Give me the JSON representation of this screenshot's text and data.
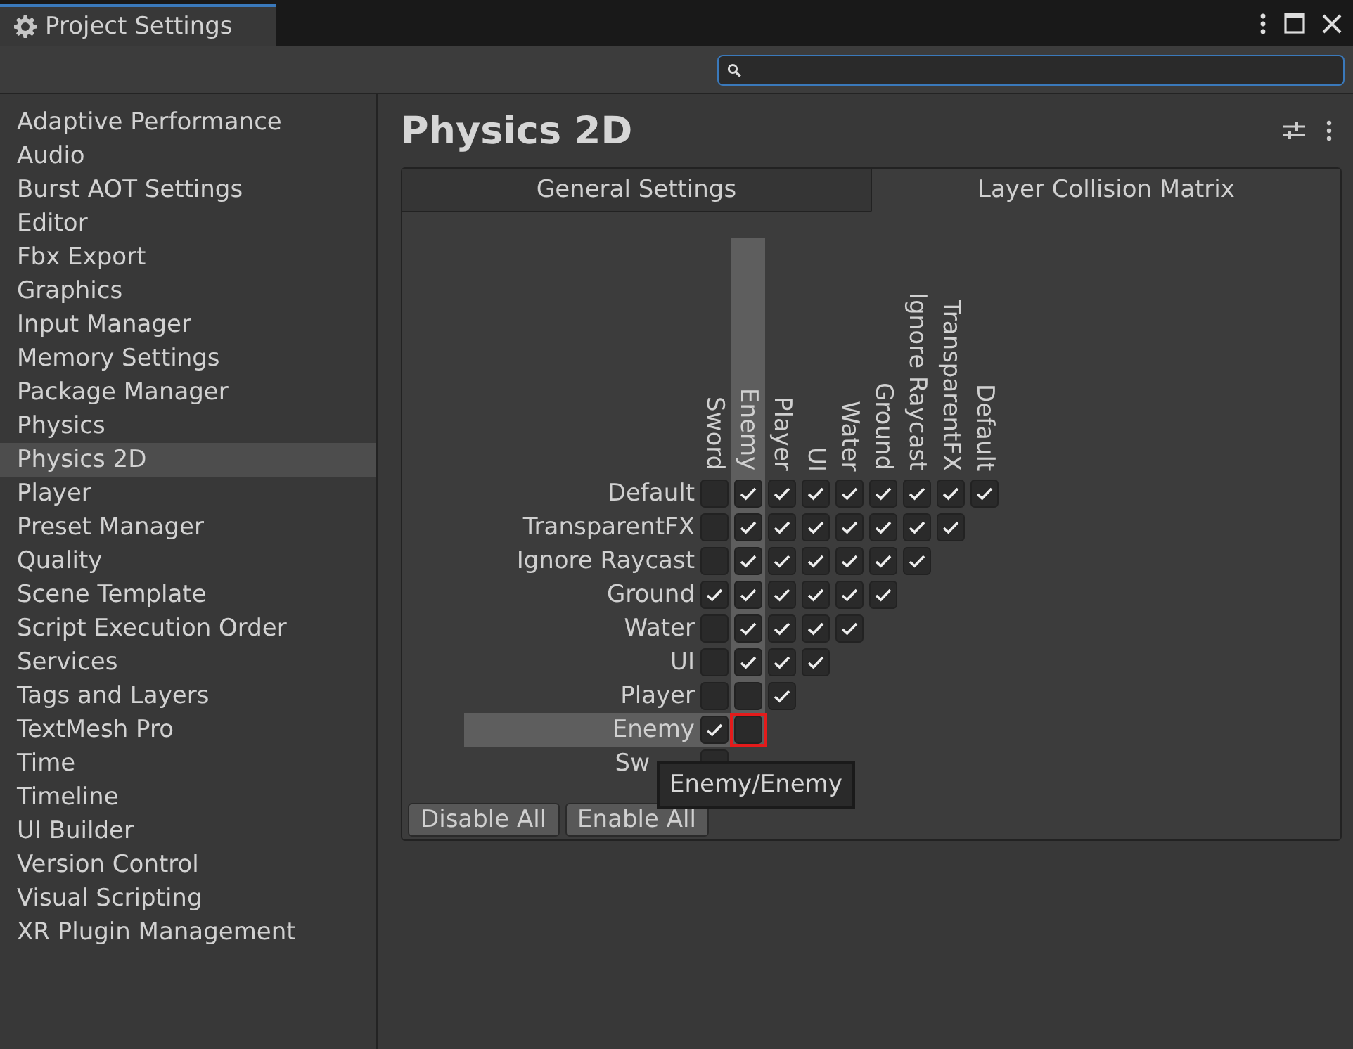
{
  "window": {
    "title": "Project Settings"
  },
  "sidebar": {
    "items": [
      {
        "label": "Adaptive Performance",
        "selected": false
      },
      {
        "label": "Audio",
        "selected": false
      },
      {
        "label": "Burst AOT Settings",
        "selected": false
      },
      {
        "label": "Editor",
        "selected": false
      },
      {
        "label": "Fbx Export",
        "selected": false
      },
      {
        "label": "Graphics",
        "selected": false
      },
      {
        "label": "Input Manager",
        "selected": false
      },
      {
        "label": "Memory Settings",
        "selected": false
      },
      {
        "label": "Package Manager",
        "selected": false
      },
      {
        "label": "Physics",
        "selected": false
      },
      {
        "label": "Physics 2D",
        "selected": true
      },
      {
        "label": "Player",
        "selected": false
      },
      {
        "label": "Preset Manager",
        "selected": false
      },
      {
        "label": "Quality",
        "selected": false
      },
      {
        "label": "Scene Template",
        "selected": false
      },
      {
        "label": "Script Execution Order",
        "selected": false
      },
      {
        "label": "Services",
        "selected": false
      },
      {
        "label": "Tags and Layers",
        "selected": false
      },
      {
        "label": "TextMesh Pro",
        "selected": false
      },
      {
        "label": "Time",
        "selected": false
      },
      {
        "label": "Timeline",
        "selected": false
      },
      {
        "label": "UI Builder",
        "selected": false
      },
      {
        "label": "Version Control",
        "selected": false
      },
      {
        "label": "Visual Scripting",
        "selected": false
      },
      {
        "label": "XR Plugin Management",
        "selected": false
      }
    ]
  },
  "page": {
    "title": "Physics 2D"
  },
  "tabs": [
    {
      "label": "General Settings",
      "selected": false
    },
    {
      "label": "Layer Collision Matrix",
      "selected": true
    }
  ],
  "matrix": {
    "columns": [
      {
        "label": "Sword",
        "highlighted": false
      },
      {
        "label": "Enemy",
        "highlighted": true
      },
      {
        "label": "Player",
        "highlighted": false
      },
      {
        "label": "UI",
        "highlighted": false
      },
      {
        "label": "Water",
        "highlighted": false
      },
      {
        "label": "Ground",
        "highlighted": false
      },
      {
        "label": "Ignore Raycast",
        "highlighted": false
      },
      {
        "label": "TransparentFX",
        "highlighted": false
      },
      {
        "label": "Default",
        "highlighted": false
      }
    ],
    "rows": [
      {
        "label": "Default",
        "highlighted": false,
        "cells": [
          {
            "checked": false,
            "hovered": false
          },
          {
            "checked": true,
            "hovered": false
          },
          {
            "checked": true,
            "hovered": false
          },
          {
            "checked": true,
            "hovered": false
          },
          {
            "checked": true,
            "hovered": false
          },
          {
            "checked": true,
            "hovered": false
          },
          {
            "checked": true,
            "hovered": false
          },
          {
            "checked": true,
            "hovered": false
          },
          {
            "checked": true,
            "hovered": false
          }
        ]
      },
      {
        "label": "TransparentFX",
        "highlighted": false,
        "cells": [
          {
            "checked": false,
            "hovered": false
          },
          {
            "checked": true,
            "hovered": false
          },
          {
            "checked": true,
            "hovered": false
          },
          {
            "checked": true,
            "hovered": false
          },
          {
            "checked": true,
            "hovered": false
          },
          {
            "checked": true,
            "hovered": false
          },
          {
            "checked": true,
            "hovered": false
          },
          {
            "checked": true,
            "hovered": false
          }
        ]
      },
      {
        "label": "Ignore Raycast",
        "highlighted": false,
        "cells": [
          {
            "checked": false,
            "hovered": false
          },
          {
            "checked": true,
            "hovered": false
          },
          {
            "checked": true,
            "hovered": false
          },
          {
            "checked": true,
            "hovered": false
          },
          {
            "checked": true,
            "hovered": false
          },
          {
            "checked": true,
            "hovered": false
          },
          {
            "checked": true,
            "hovered": false
          }
        ]
      },
      {
        "label": "Ground",
        "highlighted": false,
        "cells": [
          {
            "checked": true,
            "hovered": false
          },
          {
            "checked": true,
            "hovered": false
          },
          {
            "checked": true,
            "hovered": false
          },
          {
            "checked": true,
            "hovered": false
          },
          {
            "checked": true,
            "hovered": false
          },
          {
            "checked": true,
            "hovered": false
          }
        ]
      },
      {
        "label": "Water",
        "highlighted": false,
        "cells": [
          {
            "checked": false,
            "hovered": false
          },
          {
            "checked": true,
            "hovered": false
          },
          {
            "checked": true,
            "hovered": false
          },
          {
            "checked": true,
            "hovered": false
          },
          {
            "checked": true,
            "hovered": false
          }
        ]
      },
      {
        "label": "UI",
        "highlighted": false,
        "cells": [
          {
            "checked": false,
            "hovered": false
          },
          {
            "checked": true,
            "hovered": false
          },
          {
            "checked": true,
            "hovered": false
          },
          {
            "checked": true,
            "hovered": false
          }
        ]
      },
      {
        "label": "Player",
        "highlighted": false,
        "cells": [
          {
            "checked": false,
            "hovered": false
          },
          {
            "checked": false,
            "hovered": false
          },
          {
            "checked": true,
            "hovered": false
          }
        ]
      },
      {
        "label": "Enemy",
        "highlighted": true,
        "cells": [
          {
            "checked": true,
            "hovered": false
          },
          {
            "checked": false,
            "hovered": true
          }
        ]
      },
      {
        "label": "Sw",
        "highlighted": false,
        "cells": [
          {
            "checked": false,
            "hovered": false
          }
        ]
      }
    ],
    "tooltip": "Enemy/Enemy"
  },
  "buttons": [
    "Disable All",
    "Enable All"
  ]
}
